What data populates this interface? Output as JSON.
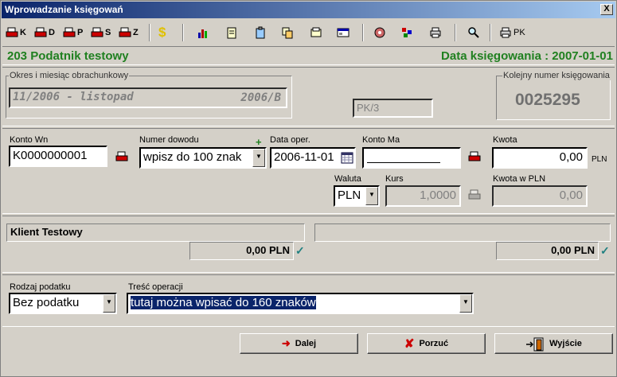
{
  "window": {
    "title": "Wprowadzanie księgowań",
    "close": "X"
  },
  "toolbar": {
    "doc_buttons": [
      "K",
      "D",
      "P",
      "S",
      "Z"
    ],
    "pk_label": "PK"
  },
  "header": {
    "taxpayer": "203 Podatnik testowy",
    "booking_date": "Data księgowania : 2007-01-01"
  },
  "period": {
    "label": "Okres i miesiąc obrachunkowy",
    "value": "11/2006 - listopad",
    "code": "2006/B",
    "pk_value": "PK/3"
  },
  "sequence": {
    "label": "Kolejny numer księgowania",
    "value": "0025295"
  },
  "form": {
    "konto_wn_label": "Konto Wn",
    "konto_wn_value": "K0000000001",
    "numer_dowodu_label": "Numer dowodu",
    "numer_dowodu_value": "wpisz do 100 znak",
    "plus": "+",
    "data_oper_label": "Data oper.",
    "data_oper_value": "2006-11-01",
    "konto_ma_label": "Konto Ma",
    "kwota_label": "Kwota",
    "kwota_value": "0,00",
    "kwota_currency": "PLN",
    "waluta_label": "Waluta",
    "waluta_value": "PLN",
    "kurs_label": "Kurs",
    "kurs_value": "1,0000",
    "kwota_pln_label": "Kwota w PLN",
    "kwota_pln_value": "0,00"
  },
  "clients": {
    "left_name": "Klient Testowy",
    "left_amount": "0,00 PLN",
    "right_name": "",
    "right_amount": "0,00 PLN"
  },
  "tax": {
    "rodzaj_label": "Rodzaj podatku",
    "rodzaj_value": "Bez podatku",
    "tresc_label": "Treść operacji",
    "tresc_value": "tutaj można wpisać do 160 znaków"
  },
  "buttons": {
    "dalej": "Dalej",
    "porzuc": "Porzuć",
    "wyjscie": "Wyjście"
  },
  "colors": {
    "accent_green": "#208020",
    "title_blue": "#0a246a",
    "selection": "#0a246a"
  }
}
